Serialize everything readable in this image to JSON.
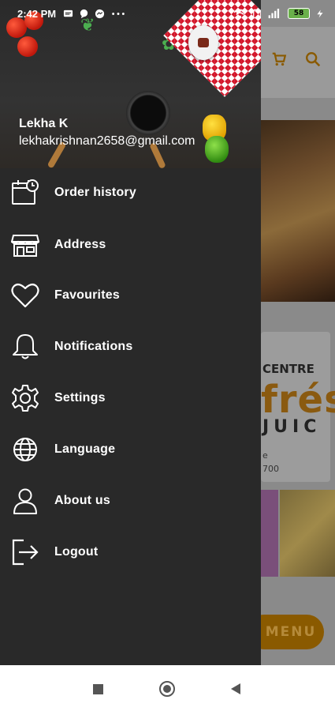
{
  "status_bar": {
    "time": "2:42 PM",
    "left_icons": [
      "message-icon",
      "chat-icon",
      "messenger-icon",
      "more-icon"
    ],
    "right_icons": [
      "wifi-icon",
      "sim-icon",
      "signal-icon",
      "battery-icon",
      "charging-icon"
    ],
    "battery_level": "58"
  },
  "drawer": {
    "user": {
      "name": "Lekha K",
      "email": "lekhakrishnan2658@gmail.com"
    },
    "menu": [
      {
        "label": "Order history",
        "icon": "calendar-clock-icon"
      },
      {
        "label": "Address",
        "icon": "store-icon"
      },
      {
        "label": "Favourites",
        "icon": "heart-icon"
      },
      {
        "label": "Notifications",
        "icon": "bell-icon"
      },
      {
        "label": "Settings",
        "icon": "gear-icon"
      },
      {
        "label": "Language",
        "icon": "globe-icon"
      },
      {
        "label": "About us",
        "icon": "user-icon"
      },
      {
        "label": "Logout",
        "icon": "logout-icon"
      }
    ]
  },
  "background_app": {
    "card_title_1": "CENTRE",
    "card_title_2": "frés",
    "card_title_3": "JUIC",
    "card_small_1": "e",
    "card_small_2": "700",
    "menu_button": "MENU"
  },
  "colors": {
    "drawer_bg": "#292929",
    "accent": "#8a5a00",
    "nav_bar": "#ffffff"
  },
  "nav_bar": {
    "buttons": [
      "recents-button",
      "home-button",
      "back-button"
    ]
  }
}
